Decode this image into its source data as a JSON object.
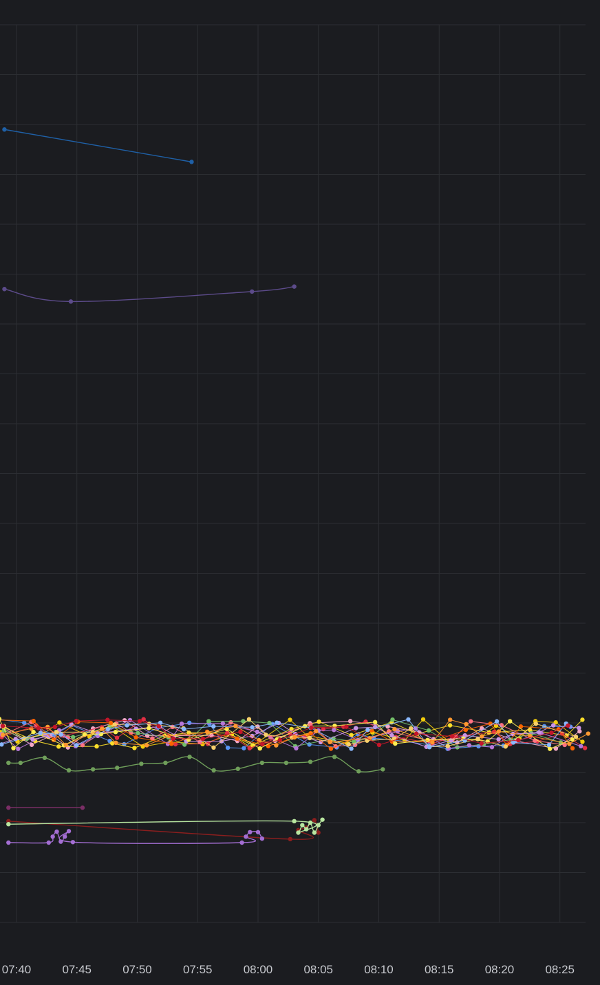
{
  "chart_data": {
    "type": "line",
    "title": "",
    "xlabel": "",
    "ylabel": "",
    "grid": true,
    "legend": "bottom (cut off)",
    "x_ticks": [
      "07:40",
      "07:45",
      "07:50",
      "07:55",
      "08:00",
      "08:05",
      "08:10",
      "08:15",
      "08:20",
      "08:25"
    ],
    "x_range_minutes": [
      -0.8,
      28.1
    ],
    "y_range": [
      0,
      18
    ],
    "colors": {
      "background": "#1b1c20",
      "grid": "#2c2e33",
      "tick_text": "#c7c9ce"
    },
    "series": [
      {
        "color": "#1f60a6",
        "points": [
          [
            -1,
            15.9
          ],
          [
            14.5,
            15.25
          ]
        ]
      },
      {
        "color": "#5c4b8a",
        "points": [
          [
            -1,
            12.7
          ],
          [
            4.5,
            12.45
          ],
          [
            19.5,
            12.65
          ],
          [
            34.5,
            12.75
          ]
        ]
      },
      {
        "color": "#6f9e5a",
        "points": [
          [
            -1,
            3.2
          ],
          [
            0.5,
            3.2
          ],
          [
            3.5,
            3.3
          ],
          [
            6.5,
            3.05
          ],
          [
            9.5,
            3.07
          ],
          [
            12.5,
            3.1
          ],
          [
            15.5,
            3.18
          ],
          [
            18.5,
            3.2
          ],
          [
            21.5,
            3.32
          ],
          [
            24.5,
            3.05
          ],
          [
            27.5,
            3.08
          ],
          [
            30.5,
            3.2
          ],
          [
            33.5,
            3.2
          ],
          [
            36.5,
            3.22
          ],
          [
            39.5,
            3.32
          ],
          [
            42.5,
            3.03
          ],
          [
            45.5,
            3.07
          ]
        ]
      },
      {
        "color": "#7b2e66",
        "points": [
          [
            -1,
            2.3
          ],
          [
            8.2,
            2.3
          ]
        ]
      },
      {
        "color": "#8a1e1e",
        "points": [
          [
            -1,
            2.03
          ],
          [
            34.0,
            1.67
          ],
          [
            35.0,
            1.85
          ],
          [
            36.0,
            1.9
          ],
          [
            37.0,
            2.05
          ],
          [
            37.5,
            1.8
          ]
        ]
      },
      {
        "color": "#b8e6a0",
        "points": [
          [
            -1,
            1.97
          ],
          [
            34.5,
            2.03
          ],
          [
            35.0,
            1.8
          ],
          [
            35.5,
            1.95
          ],
          [
            36.0,
            1.87
          ],
          [
            36.5,
            2.0
          ],
          [
            37.0,
            1.8
          ],
          [
            37.5,
            1.95
          ],
          [
            38.0,
            2.06
          ]
        ]
      },
      {
        "color": "#a46ed3",
        "points": [
          [
            -1,
            1.6
          ],
          [
            4.0,
            1.6
          ],
          [
            4.5,
            1.72
          ],
          [
            5.0,
            1.82
          ],
          [
            5.5,
            1.62
          ],
          [
            6.0,
            1.72
          ],
          [
            6.5,
            1.83
          ],
          [
            7.0,
            1.61
          ],
          [
            28.0,
            1.6
          ],
          [
            28.5,
            1.72
          ],
          [
            29.0,
            1.81
          ],
          [
            30.0,
            1.81
          ],
          [
            30.5,
            1.68
          ]
        ]
      }
    ],
    "noise_band": {
      "y_center": 3.78,
      "y_spread": 0.3,
      "series_colors": [
        "#f2cc0c",
        "#f2a7c5",
        "#5794f2",
        "#fade2a",
        "#e02f44",
        "#ff7383",
        "#73bf69",
        "#b877d9",
        "#ca95e5",
        "#fa6400",
        "#ffee52",
        "#f8d06b",
        "#8ab8ff",
        "#ff9830",
        "#c4162a"
      ]
    }
  }
}
